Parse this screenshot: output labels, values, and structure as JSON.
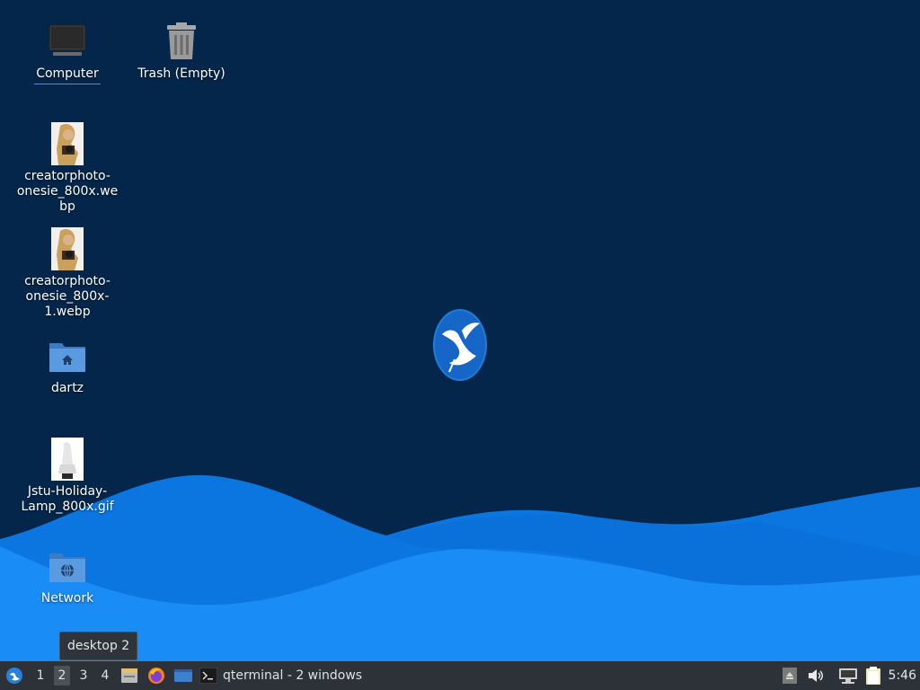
{
  "desktop": {
    "icons": [
      {
        "label": "Computer",
        "icon": "monitor-icon"
      },
      {
        "label": "Trash (Empty)",
        "icon": "trash-icon"
      },
      {
        "label": "creatorphoto-onesie_800x.webp",
        "icon": "image-thumbnail"
      },
      {
        "label": "creatorphoto-onesie_800x-1.webp",
        "icon": "image-thumbnail"
      },
      {
        "label": "dartz",
        "icon": "home-folder-icon"
      },
      {
        "label": "Jstu-Holiday-Lamp_800x.gif",
        "icon": "image-thumbnail"
      },
      {
        "label": "Network",
        "icon": "network-folder-icon"
      }
    ],
    "center_logo": "lubuntu-bird-logo"
  },
  "tooltip": {
    "text": "desktop 2"
  },
  "taskbar": {
    "menu_icon": "lubuntu-menu-icon",
    "workspaces": [
      "1",
      "2",
      "3",
      "4"
    ],
    "active_workspace": "2",
    "quicklaunch": [
      "file-manager-icon",
      "firefox-icon",
      "show-desktop-icon"
    ],
    "task": {
      "label": "qterminal - 2 windows",
      "icon": "terminal-icon"
    },
    "tray": [
      "eject-icon",
      "volume-icon",
      "network-icon",
      "clipboard-icon"
    ],
    "clock": "5:46"
  },
  "colors": {
    "desktop_bg": "#03264a",
    "wave_light": "#1e90ff",
    "wave_dark": "#0a6fd8",
    "taskbar_bg": "#2d3238",
    "folder_blue": "#4a8ad4"
  }
}
